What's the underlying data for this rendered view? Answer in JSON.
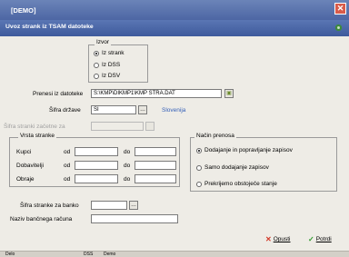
{
  "window": {
    "title": "[DEMO]"
  },
  "dialog": {
    "title": "Uvoz strank iz TSAM datoteke"
  },
  "izvor": {
    "label": "Izvor",
    "options": [
      "Iz strank",
      "Iz DSS",
      "Iz DSV"
    ],
    "selected": 0
  },
  "form": {
    "prenos_label": "Prenesi iz datoteke",
    "prenos_value": "S:\\KMP\\DIKMP1\\KMP STRA.DAT",
    "drzava_label": "Šifra države",
    "drzava_value": "SI",
    "drzava_name": "Slovenija",
    "sifra_label": "Šifra stranki začetne za"
  },
  "vrsta": {
    "label": "Vrsta stranke",
    "od": "od",
    "do": "do",
    "rows": [
      "Kupci",
      "Dobavitelji",
      "Obraje"
    ]
  },
  "nacin": {
    "label": "Način prenosa",
    "options": [
      "Dodajanje in popravljanje zapisov",
      "Samo dodajanje zapisov",
      "Prekrijemo obstoječe stanje"
    ],
    "selected": 0
  },
  "banka": {
    "sifra_label": "Šifra stranke za banko",
    "naziv_label": "Naziv bančnega računa"
  },
  "buttons": {
    "cancel": "Opusti",
    "ok": "Potrdi"
  },
  "status": {
    "left": "Delo",
    "middle": "DSS",
    "right": "Demo"
  }
}
